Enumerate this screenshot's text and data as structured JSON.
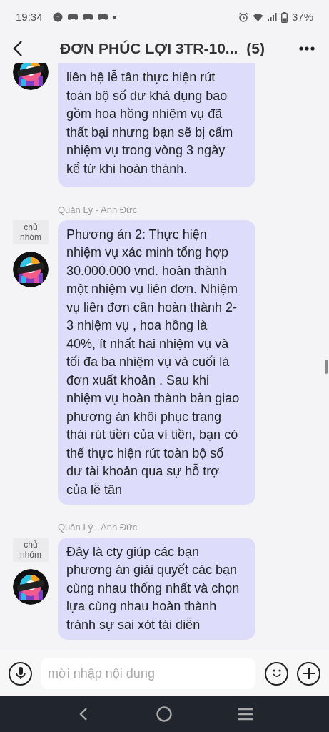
{
  "status_bar": {
    "time": "19:34",
    "battery": "37%"
  },
  "header": {
    "title": "ĐƠN PHÚC LỢI 3TR-10...",
    "member_count": "(5)"
  },
  "messages": [
    {
      "text": "liên hệ lễ tân thực hiện rút toàn bộ số dư khả dụng bao gồm hoa hồng nhiệm vụ đã thất bại nhưng bạn sẽ bị cấm nhiệm vụ trong vòng 3 ngày kể từ khi hoàn thành."
    },
    {
      "sender": "Quản Lý - Anh Đức",
      "badge": "chủ nhóm",
      "text": "Phương án 2: Thực hiện nhiệm vụ xác minh tổng hợp 30.000.000 vnd. hoàn thành một nhiệm vụ liên đơn. Nhiệm vụ liên đơn cần hoàn thành 2-3 nhiệm vụ , hoa hồng là 40%, ít nhất hai nhiệm vụ và tối đa ba nhiệm vụ và cuối là đơn xuất khoản . Sau khi nhiệm vụ hoàn thành bàn giao phương án khôi phục trạng thái rút tiền của ví tiền, bạn có thể thực hiện rút toàn bộ số dư tài khoản qua sự hỗ trợ của lễ tân"
    },
    {
      "sender": "Quản Lý - Anh Đức",
      "badge": "chủ nhóm",
      "text": "Đây là cty giúp các bạn phương án giải quyết các bạn cùng nhau thống nhất và chọn lựa cùng nhau hoàn thành tránh sự sai xót tái diễn"
    }
  ],
  "composer": {
    "placeholder": "mời nhập nội dung"
  }
}
